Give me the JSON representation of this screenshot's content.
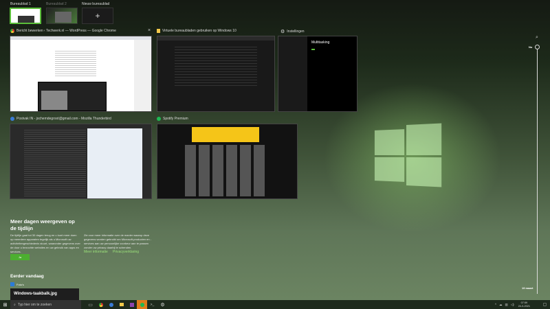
{
  "desktops": [
    {
      "label": "Bureaublad 1",
      "active": true
    },
    {
      "label": "Bureaublad 2",
      "active": false
    },
    {
      "label": "Nieuw bureaublad",
      "icon": "plus-icon"
    }
  ],
  "windows": [
    {
      "title": "Bericht bewerken ‹ Techwerk.nl — WordPress — Google Chrome",
      "icon": "chrome-icon"
    },
    {
      "title": "Virtuele bureaubladen gebruiken op Windows 10",
      "icon": "folder-icon"
    },
    {
      "title": "Instellingen",
      "icon": "gear-icon",
      "page_heading": "Multitasking"
    },
    {
      "title": "Postvak IN - jochemdegroot@gmail.com - Mozilla Thunderbird",
      "icon": "thunderbird-icon"
    },
    {
      "title": "Spotify Premium",
      "icon": "spotify-icon"
    }
  ],
  "timeline": {
    "heading": "Meer dagen weergeven op de tijdlijn",
    "body_left": "De tijdlijn gaat tot 30 dagen terug en u kunt meer doen op meerdere apparaten tegelijk als u Microsoft uw activiteitengeschiedenis stuurt, waaronder gegevens over de door u bezochte websites en uw gebruik van apps en services.",
    "body_right": "Zie voor meer informatie over de manier waarop deze gegevens worden gebruikt om Microsoft-producten en -services aan uw persoonlijke voorkeur aan te passen zonder uw privacy daarbij te schenden.",
    "yes_button": "Ja",
    "link_more": "Meer informatie",
    "link_privacy": "Privacyverklaring",
    "section": "Eerder vandaag",
    "app": "Foto's",
    "card_title": "Windows-taakbalk.jpg"
  },
  "scrollbar": {
    "top_label": "Nu",
    "bottom_label": "19 maart"
  },
  "taskbar": {
    "search_placeholder": "Typ hier om te zoeken",
    "time": "07:59",
    "date": "24-3-2021",
    "accent": "#e07b1a"
  }
}
